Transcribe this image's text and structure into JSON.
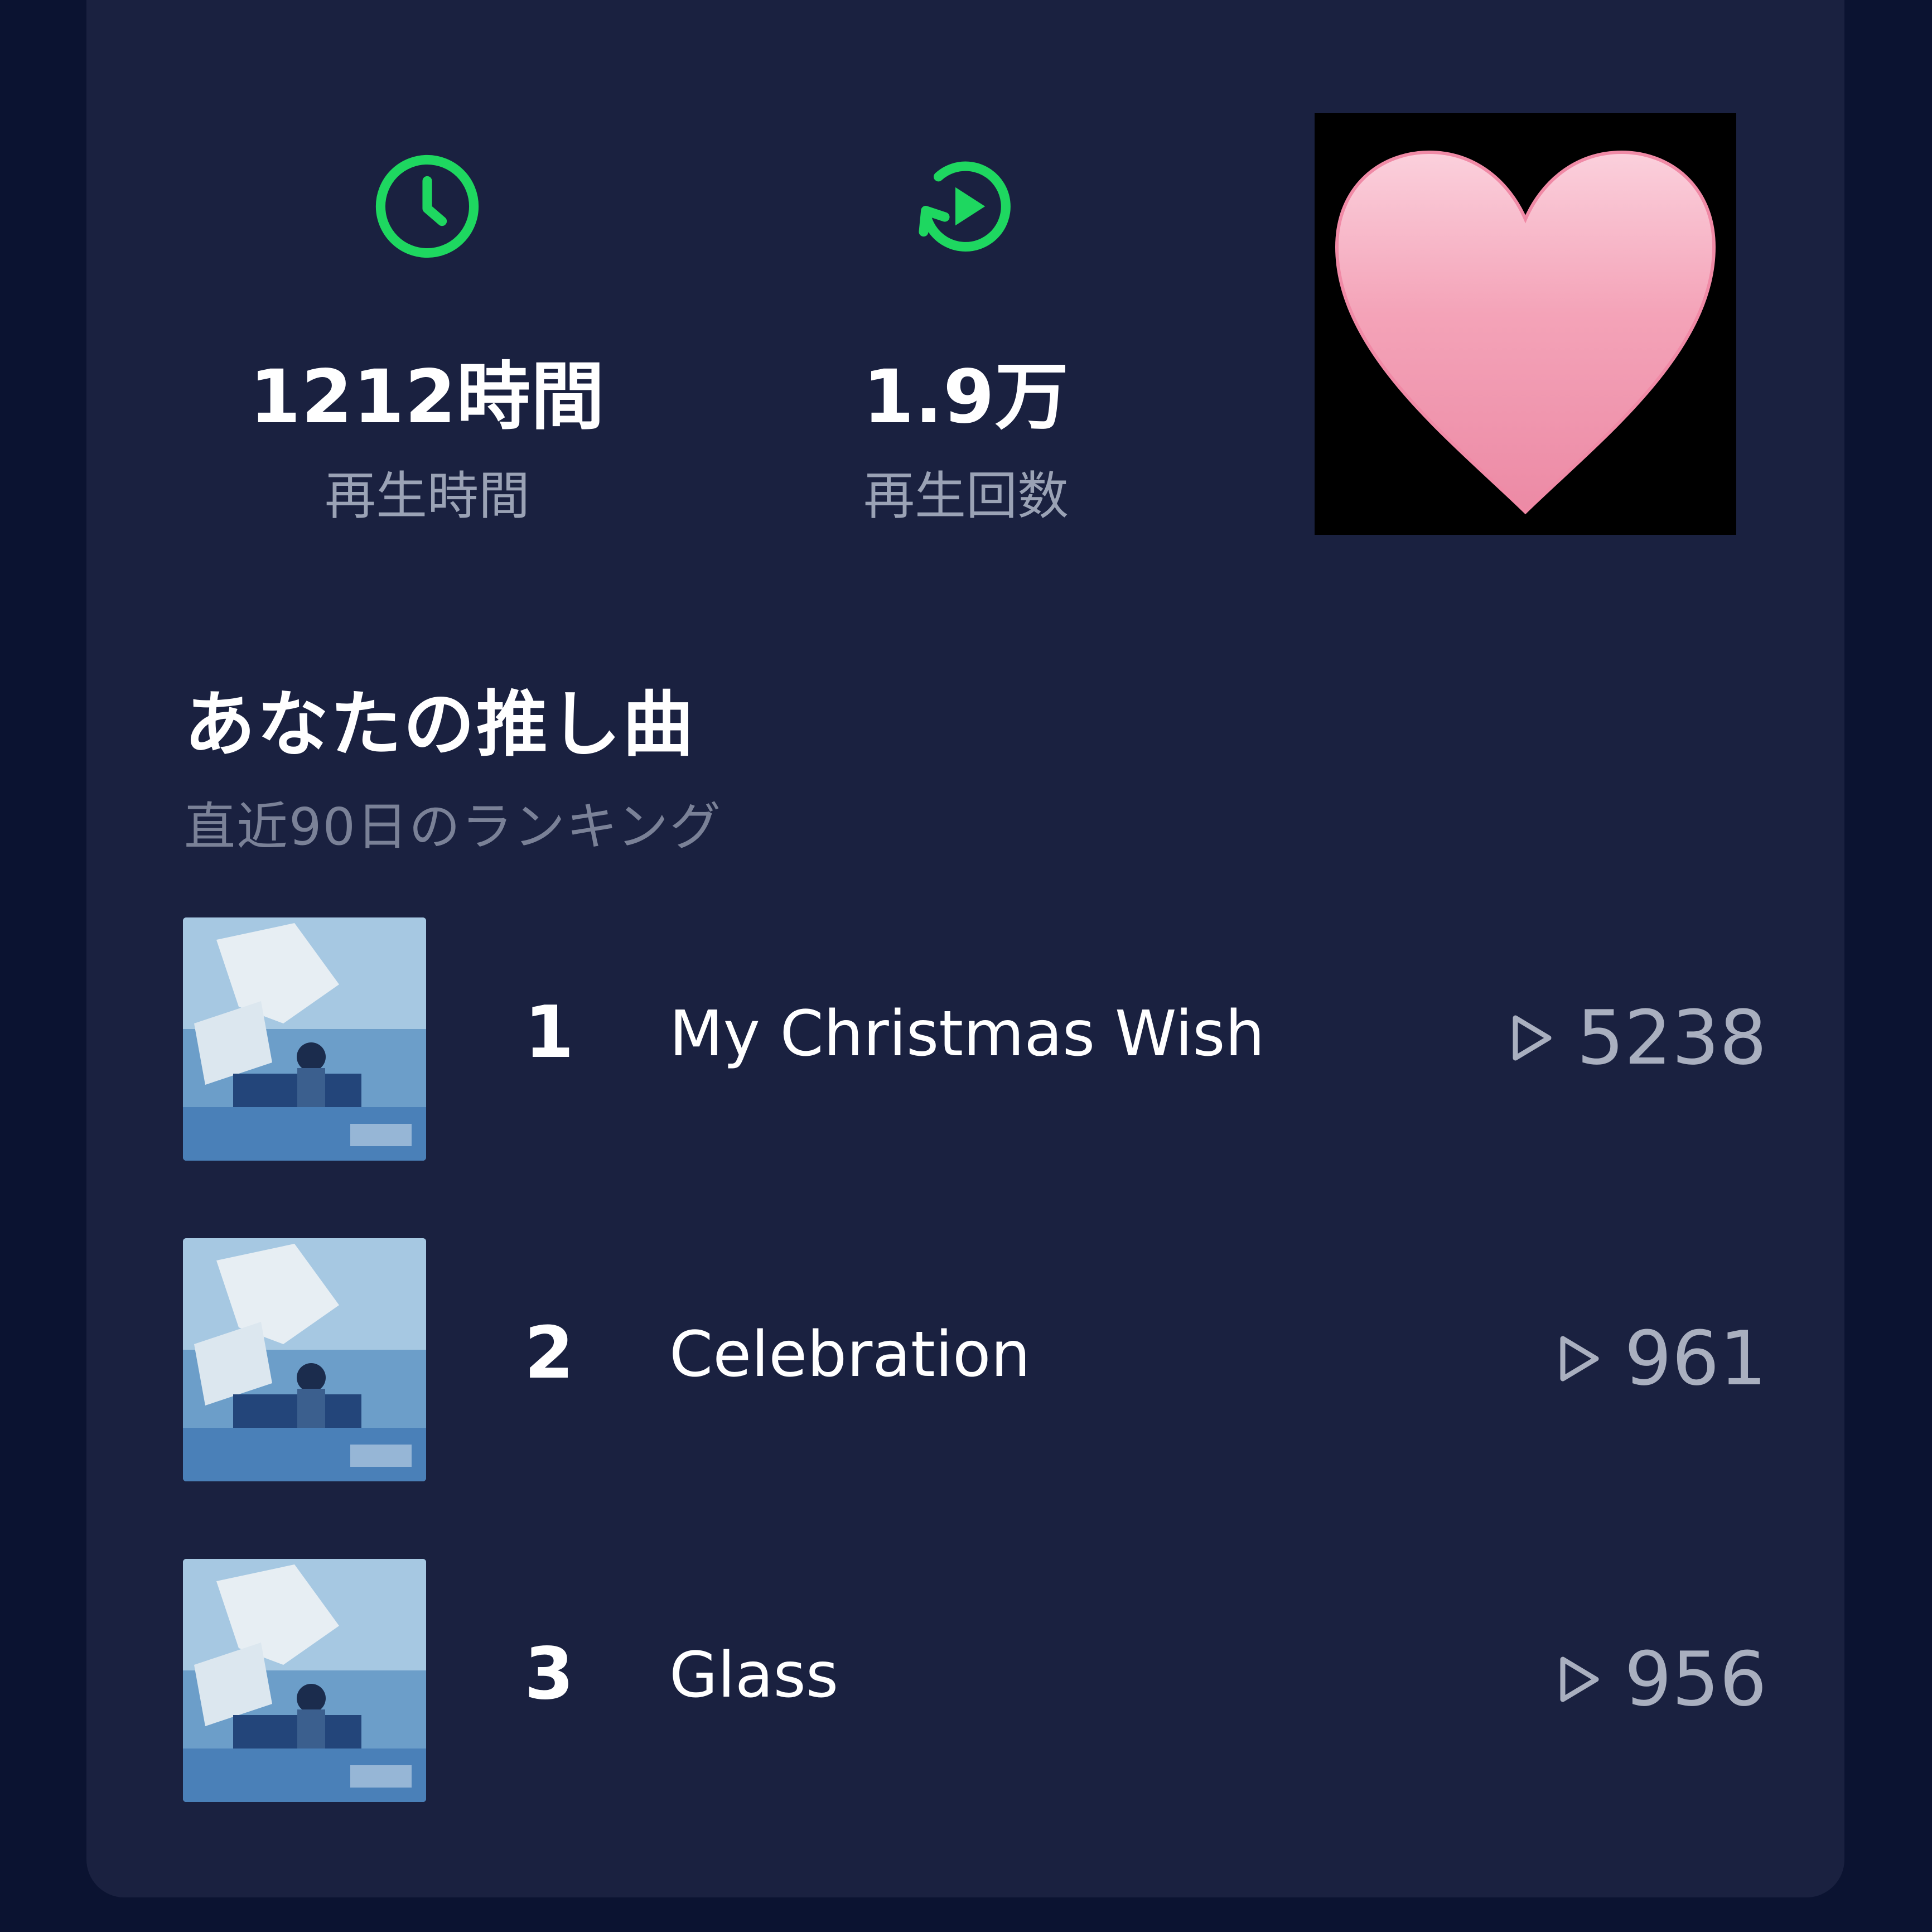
{
  "stats": {
    "play_time": {
      "value": "1212時間",
      "label": "再生時間",
      "icon": "clock-icon"
    },
    "play_count": {
      "value": "1.9万",
      "label": "再生回数",
      "icon": "replay-icon"
    }
  },
  "reaction": {
    "icon": "pink-heart-icon"
  },
  "ranking": {
    "title": "あなたの推し曲",
    "subtitle": "直近90日のランキング",
    "tracks": [
      {
        "rank": "1",
        "title": "My Christmas Wish",
        "plays": "5238"
      },
      {
        "rank": "2",
        "title": "Celebration",
        "plays": "961"
      },
      {
        "rank": "3",
        "title": "Glass",
        "plays": "956"
      }
    ]
  },
  "colors": {
    "background": "#0b1331",
    "card": "#1a2140",
    "accent_green": "#1ed760",
    "heart_pink": "#f4a3b8",
    "muted_text": "#9aa2b5"
  }
}
